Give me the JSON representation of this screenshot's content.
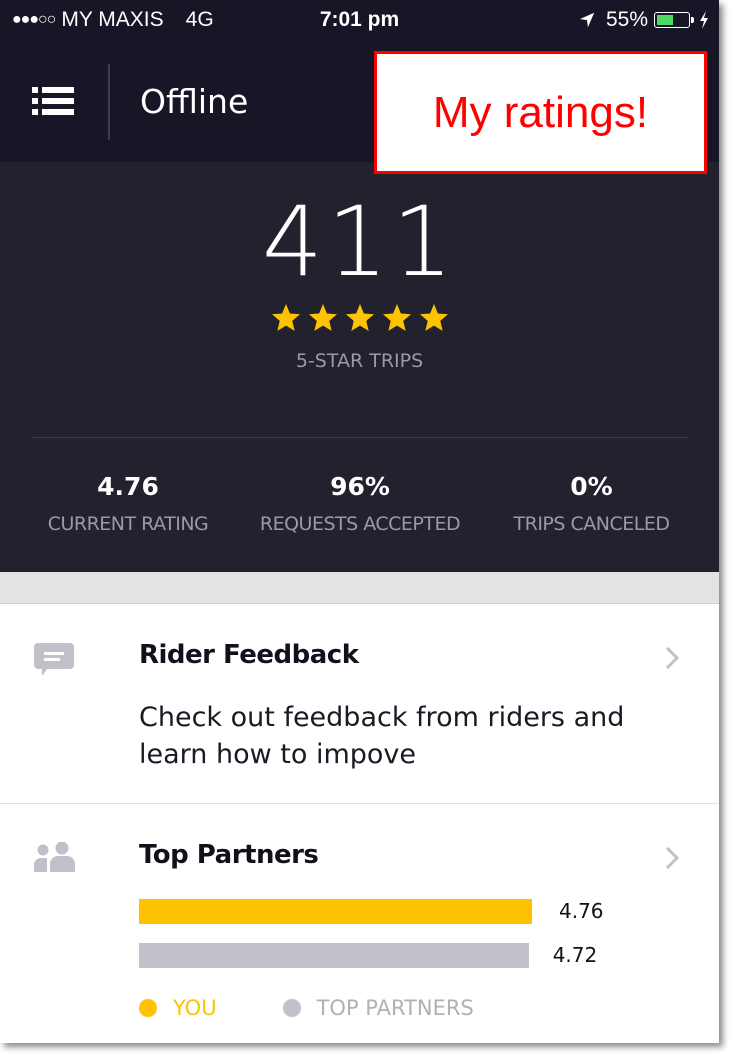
{
  "status_bar": {
    "signal_dots": "●●●○○",
    "carrier": "MY MAXIS",
    "network": "4G",
    "time": "7:01 pm",
    "location_icon": "location-arrow-icon",
    "battery_percent": "55%",
    "battery_level": 0.55,
    "charging_icon": "lightning-bolt-icon"
  },
  "nav": {
    "menu_icon": "list-menu-icon",
    "status_title": "Offline"
  },
  "callout": {
    "text": "My ratings!",
    "color": "#ff0000"
  },
  "summary": {
    "five_star_count": "411",
    "stars_shown": 5,
    "star_label": "5-STAR TRIPS",
    "metrics": [
      {
        "value": "4.76",
        "label": "CURRENT RATING"
      },
      {
        "value": "96%",
        "label": "REQUESTS ACCEPTED"
      },
      {
        "value": "0%",
        "label": "TRIPS CANCELED"
      }
    ]
  },
  "rider_feedback": {
    "icon": "chat-bubble-icon",
    "title": "Rider Feedback",
    "description": "Check out feedback from riders and learn how to impove"
  },
  "top_partners": {
    "icon": "people-icon",
    "title": "Top Partners",
    "bars": [
      {
        "name": "YOU",
        "value": "4.76",
        "color": "#ffc200"
      },
      {
        "name": "TOP PARTNERS",
        "value": "4.72",
        "color": "#c0c0c8"
      }
    ],
    "legend": [
      {
        "label": "YOU",
        "color": "#ffc200"
      },
      {
        "label": "TOP PARTNERS",
        "color": "#c0c0c8"
      }
    ]
  },
  "colors": {
    "header_bg": "#161626",
    "panel_bg": "#22222f",
    "star": "#ffc200",
    "accent_yellow": "#ffc200"
  }
}
